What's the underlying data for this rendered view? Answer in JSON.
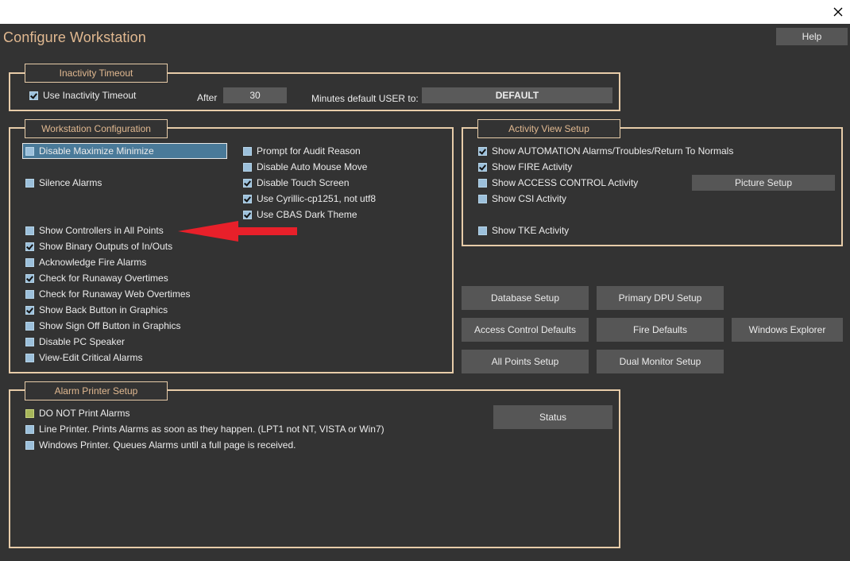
{
  "app": {
    "title": "Configure Workstation",
    "help_label": "Help"
  },
  "inactivity": {
    "legend": "Inactivity Timeout",
    "use_label": "Use Inactivity Timeout",
    "after_label": "After",
    "minutes_value": "30",
    "minutes_label": "Minutes default USER to:",
    "default_user_value": "DEFAULT"
  },
  "workstation": {
    "legend": "Workstation Configuration",
    "left_items": [
      {
        "label": "Disable Maximize Minimize",
        "checked": false
      },
      {
        "label": "Silence Alarms",
        "checked": false
      },
      {
        "label": "Show Controllers in All Points",
        "checked": false
      },
      {
        "label": "Show Binary Outputs of In/Outs",
        "checked": true
      },
      {
        "label": "Acknowledge Fire Alarms",
        "checked": false
      },
      {
        "label": "Check for Runaway Overtimes",
        "checked": true
      },
      {
        "label": "Check for Runaway Web Overtimes",
        "checked": false
      },
      {
        "label": "Show Back Button in Graphics",
        "checked": true
      },
      {
        "label": "Show Sign Off Button in Graphics",
        "checked": false
      },
      {
        "label": "Disable PC Speaker",
        "checked": false
      },
      {
        "label": "View-Edit Critical Alarms",
        "checked": false
      }
    ],
    "right_items": [
      {
        "label": "Prompt for Audit Reason",
        "checked": false
      },
      {
        "label": "Disable Auto Mouse Move",
        "checked": false
      },
      {
        "label": "Disable Touch Screen",
        "checked": true
      },
      {
        "label": "Use Cyrillic-cp1251, not utf8",
        "checked": true
      },
      {
        "label": "Use CBAS Dark Theme",
        "checked": true
      }
    ]
  },
  "activity": {
    "legend": "Activity View Setup",
    "items": [
      {
        "label": "Show AUTOMATION Alarms/Troubles/Return To Normals",
        "checked": true
      },
      {
        "label": "Show FIRE Activity",
        "checked": true
      },
      {
        "label": "Show ACCESS CONTROL Activity",
        "checked": false
      },
      {
        "label": "Show CSI Activity",
        "checked": false
      },
      {
        "label": "Show TKE Activity",
        "checked": false
      }
    ],
    "picture_setup_label": "Picture Setup"
  },
  "buttons": {
    "database_setup": "Database Setup",
    "primary_dpu_setup": "Primary DPU Setup",
    "access_control_defaults": "Access Control Defaults",
    "fire_defaults": "Fire Defaults",
    "windows_explorer": "Windows Explorer",
    "all_points_setup": "All Points Setup",
    "dual_monitor_setup": "Dual Monitor Setup"
  },
  "printer": {
    "legend": "Alarm Printer Setup",
    "items": [
      {
        "label": "DO NOT Print Alarms",
        "selected": true
      },
      {
        "label": "Line Printer.  Prints Alarms as soon as they happen.  (LPT1 not NT, VISTA or Win7)",
        "selected": false
      },
      {
        "label": "Windows Printer.  Queues Alarms until a full page is received.",
        "selected": false
      }
    ],
    "status_label": "Status"
  },
  "colors": {
    "background": "#333333",
    "accent": "#e0b890",
    "button": "#565656",
    "arrow": "#e8202a"
  }
}
